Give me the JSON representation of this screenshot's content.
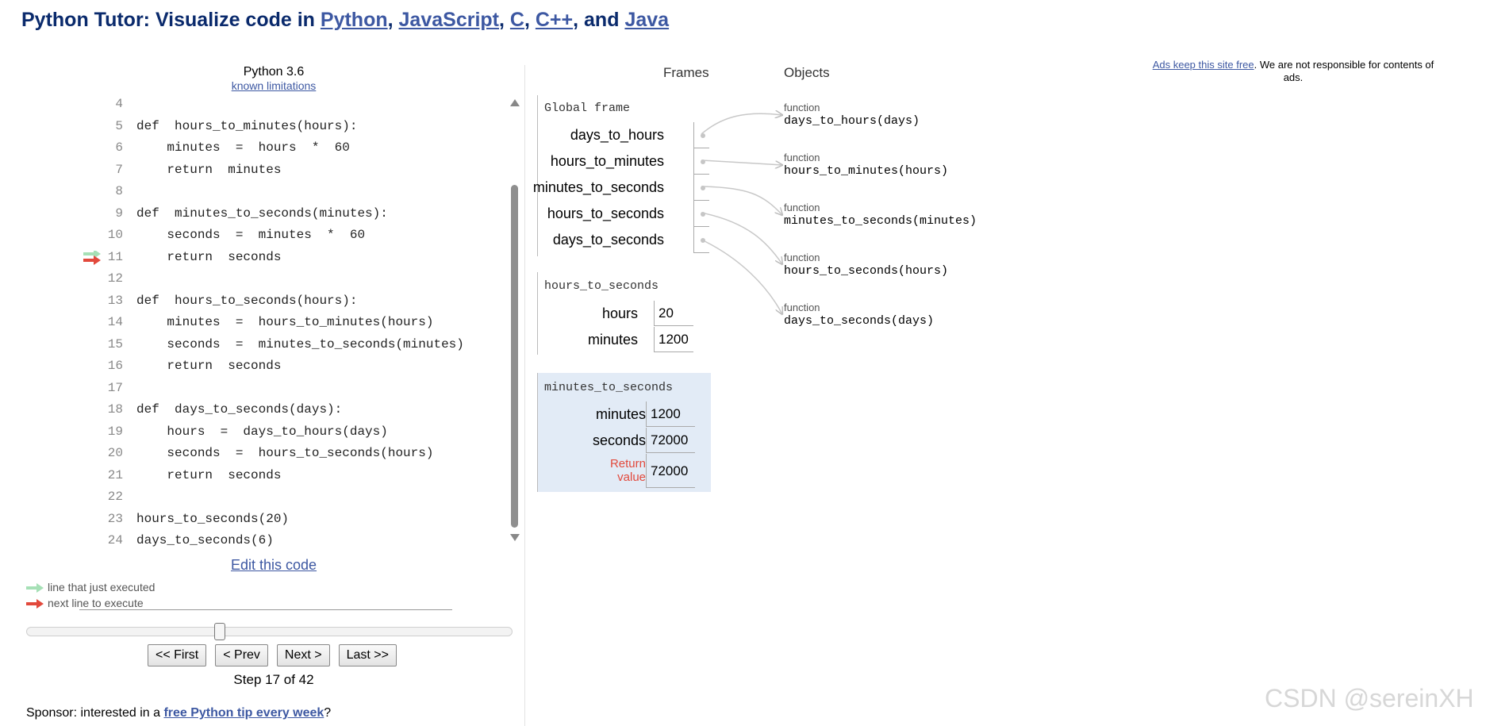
{
  "header": {
    "prefix": "Python Tutor: Visualize code in ",
    "langs": [
      "Python",
      "JavaScript",
      "C",
      "C++",
      "Java"
    ],
    "sep1": ", ",
    "sep2": ", ",
    "sep3": ", ",
    "sep4": ", and "
  },
  "editor": {
    "language": "Python 3.6",
    "limitations_link": "known limitations",
    "lines": [
      {
        "num": "4",
        "text": ""
      },
      {
        "num": "5",
        "text": "def  hours_to_minutes(hours):"
      },
      {
        "num": "6",
        "text": "    minutes  =  hours  *  60"
      },
      {
        "num": "7",
        "text": "    return  minutes"
      },
      {
        "num": "8",
        "text": ""
      },
      {
        "num": "9",
        "text": "def  minutes_to_seconds(minutes):"
      },
      {
        "num": "10",
        "text": "    seconds  =  minutes  *  60"
      },
      {
        "num": "11",
        "text": "    return  seconds"
      },
      {
        "num": "12",
        "text": ""
      },
      {
        "num": "13",
        "text": "def  hours_to_seconds(hours):"
      },
      {
        "num": "14",
        "text": "    minutes  =  hours_to_minutes(hours)"
      },
      {
        "num": "15",
        "text": "    seconds  =  minutes_to_seconds(minutes)"
      },
      {
        "num": "16",
        "text": "    return  seconds"
      },
      {
        "num": "17",
        "text": ""
      },
      {
        "num": "18",
        "text": "def  days_to_seconds(days):"
      },
      {
        "num": "19",
        "text": "    hours  =  days_to_hours(days)"
      },
      {
        "num": "20",
        "text": "    seconds  =  hours_to_seconds(hours)"
      },
      {
        "num": "21",
        "text": "    return  seconds"
      },
      {
        "num": "22",
        "text": ""
      },
      {
        "num": "23",
        "text": "hours_to_seconds(20)"
      },
      {
        "num": "24",
        "text": "days_to_seconds(6)"
      }
    ],
    "edit_link": "Edit this code"
  },
  "legend": {
    "executed": "line that just executed",
    "next": "next line to execute",
    "executed_color": "#a6e0b6",
    "next_color": "#e2493c"
  },
  "controls": {
    "first": "<< First",
    "prev": "< Prev",
    "next": "Next >",
    "last": "Last >>",
    "step_label": "Step 17 of 42",
    "step_current": 17,
    "step_total": 42
  },
  "sponsor": {
    "prefix": "Sponsor: interested in a ",
    "link": "free Python tip every week",
    "suffix": "?"
  },
  "viz": {
    "frames_header": "Frames",
    "objects_header": "Objects",
    "global_frame": {
      "name": "Global frame",
      "vars": [
        "days_to_hours",
        "hours_to_minutes",
        "minutes_to_seconds",
        "hours_to_seconds",
        "days_to_seconds"
      ]
    },
    "frame_hts": {
      "name": "hours_to_seconds",
      "vars": [
        {
          "name": "hours",
          "value": "20"
        },
        {
          "name": "minutes",
          "value": "1200"
        }
      ]
    },
    "frame_mts": {
      "name": "minutes_to_seconds",
      "vars": [
        {
          "name": "minutes",
          "value": "1200"
        },
        {
          "name": "seconds",
          "value": "72000"
        }
      ],
      "return_label": "Return\nvalue",
      "return_value": "72000",
      "highlight_color": "#e2ebf6"
    },
    "objects": [
      {
        "type": "function",
        "sig": "days_to_hours(days)"
      },
      {
        "type": "function",
        "sig": "hours_to_minutes(hours)"
      },
      {
        "type": "function",
        "sig": "minutes_to_seconds(minutes)"
      },
      {
        "type": "function",
        "sig": "hours_to_seconds(hours)"
      },
      {
        "type": "function",
        "sig": "days_to_seconds(days)"
      }
    ]
  },
  "ads": {
    "link": "Ads keep this site free",
    "text": ". We are not responsible for contents of ads."
  },
  "watermark": "CSDN @sereinXH"
}
